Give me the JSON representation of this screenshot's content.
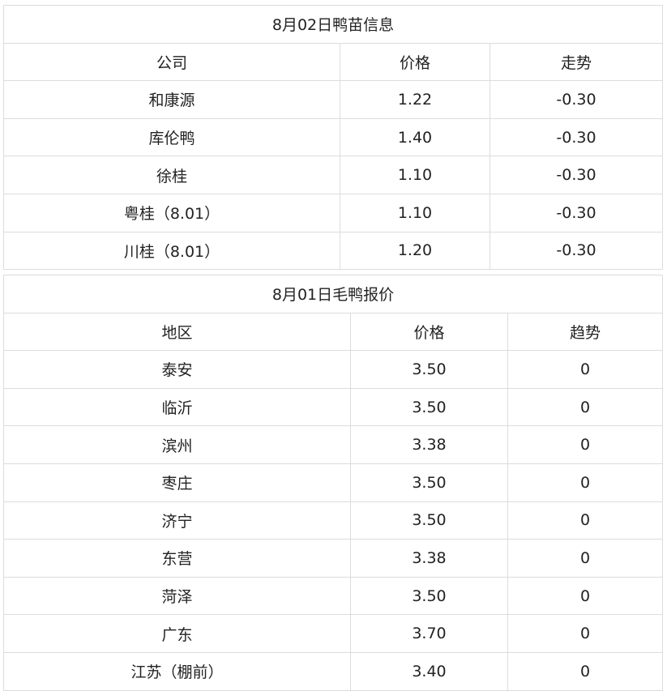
{
  "duckling": {
    "title": "8月02日鸭苗信息",
    "headers": [
      "公司",
      "价格",
      "走势"
    ],
    "rows": [
      [
        "和康源",
        "1.22",
        "-0.30"
      ],
      [
        "库伦鸭",
        "1.40",
        "-0.30"
      ],
      [
        "徐桂",
        "1.10",
        "-0.30"
      ],
      [
        "粤桂（8.01）",
        "1.10",
        "-0.30"
      ],
      [
        "川桂（8.01）",
        "1.20",
        "-0.30"
      ]
    ]
  },
  "meat_duck": {
    "title": "8月01日毛鸭报价",
    "headers": [
      "地区",
      "价格",
      "趋势"
    ],
    "rows": [
      [
        "泰安",
        "3.50",
        "0"
      ],
      [
        "临沂",
        "3.50",
        "0"
      ],
      [
        "滨州",
        "3.38",
        "0"
      ],
      [
        "枣庄",
        "3.50",
        "0"
      ],
      [
        "济宁",
        "3.50",
        "0"
      ],
      [
        "东营",
        "3.38",
        "0"
      ],
      [
        "菏泽",
        "3.50",
        "0"
      ],
      [
        "广东",
        "3.70",
        "0"
      ],
      [
        "江苏（棚前）",
        "3.40",
        "0"
      ]
    ]
  }
}
